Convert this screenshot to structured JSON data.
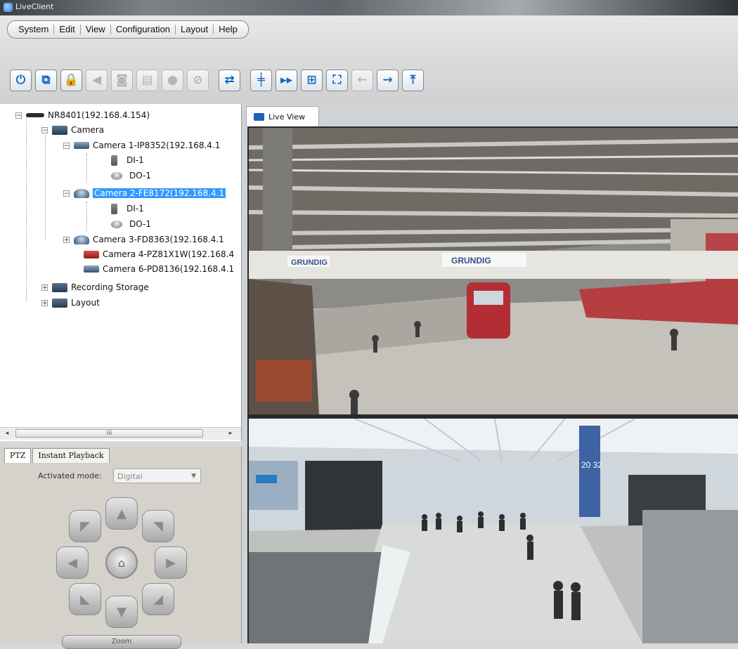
{
  "window": {
    "title": "LiveClient"
  },
  "menu": [
    "System",
    "Edit",
    "View",
    "Configuration",
    "Layout",
    "Help"
  ],
  "toolbar": [
    {
      "icon": "power-icon",
      "glyph": "⏻",
      "enabled": true
    },
    {
      "icon": "window-restore-icon",
      "glyph": "⧉",
      "enabled": true
    },
    {
      "icon": "lock-icon",
      "glyph": "🔒",
      "enabled": true
    },
    {
      "icon": "speaker-icon",
      "glyph": "◀",
      "enabled": false
    },
    {
      "icon": "camera-snapshot-icon",
      "glyph": "◙",
      "enabled": false
    },
    {
      "icon": "print-icon",
      "glyph": "▤",
      "enabled": false
    },
    {
      "icon": "record-icon",
      "glyph": "●",
      "enabled": false
    },
    {
      "icon": "no-entry-icon",
      "glyph": "⊘",
      "enabled": false
    },
    {
      "icon": "switch-view-icon",
      "glyph": "⇄",
      "enabled": true
    },
    {
      "icon": "grid-split-icon",
      "glyph": "╪",
      "enabled": true
    },
    {
      "icon": "sequence-icon",
      "glyph": "▸▸",
      "enabled": true
    },
    {
      "icon": "layout-quad-icon",
      "glyph": "⊞",
      "enabled": true
    },
    {
      "icon": "fullscreen-icon",
      "glyph": "⛶",
      "enabled": true
    },
    {
      "icon": "arrow-left-icon",
      "glyph": "←",
      "enabled": false
    },
    {
      "icon": "arrow-right-icon",
      "glyph": "→",
      "enabled": true
    },
    {
      "icon": "pin-icon",
      "glyph": "⤒",
      "enabled": true
    }
  ],
  "tree": {
    "nvr": "NR8401(192.168.4.154)",
    "camera_folder": "Camera",
    "cameras": [
      {
        "label": "Camera 1-IP8352(192.168.4.1",
        "io": [
          "DI-1",
          "DO-1"
        ]
      },
      {
        "label": "Camera 2-FE8172(192.168.4.1",
        "io": [
          "DI-1",
          "DO-1"
        ],
        "selected": true
      },
      {
        "label": "Camera 3-FD8363(192.168.4.1"
      },
      {
        "label": "Camera 4-PZ81X1W(192.168.4"
      },
      {
        "label": "Camera 6-PD8136(192.168.4.1"
      }
    ],
    "recording_storage": "Recording Storage",
    "layout": "Layout",
    "scroll_thumb_label": "iii"
  },
  "ptz": {
    "tabs": [
      "PTZ",
      "Instant Playback"
    ],
    "activated_mode_label": "Activated mode:",
    "activated_mode_value": "Digital",
    "zoom_label": "Zoom"
  },
  "liveview": {
    "tab_label": "Live View"
  },
  "scene_text": {
    "banner1": "GRUNDIG",
    "banner2": "GRUNDIG",
    "gate_sign": "20 32"
  }
}
